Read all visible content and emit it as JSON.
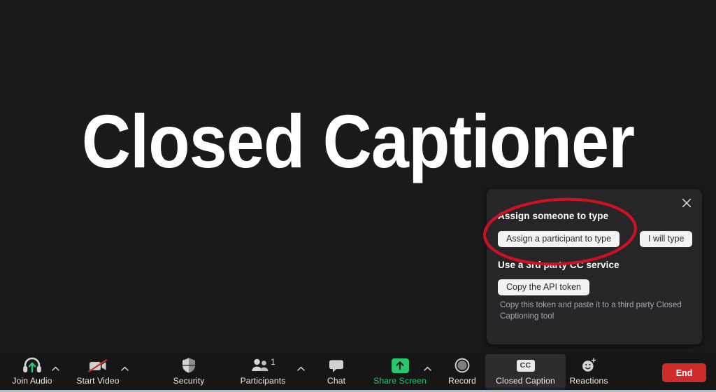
{
  "stage": {
    "title": "Closed Captioner"
  },
  "cc_panel": {
    "close_icon": "close-icon",
    "assign_heading": "Assign someone to type",
    "assign_participant_label": "Assign a participant to type",
    "i_will_type_label": "I will type",
    "third_party_heading": "Use a 3rd party CC service",
    "copy_token_label": "Copy the API token",
    "help_text": "Copy this token and paste it to a third party Closed Captioning tool"
  },
  "annotations": {
    "color": "#cc1122",
    "items": [
      {
        "name": "highlight-assign-section"
      },
      {
        "name": "highlight-closed-caption-button"
      }
    ]
  },
  "toolbar": {
    "items": [
      {
        "label": "Join Audio",
        "icon": "headset-join-audio-icon",
        "caret": true,
        "accent": "#28c76f"
      },
      {
        "label": "Start Video",
        "icon": "camera-off-icon",
        "caret": true,
        "accent": "#c0392b"
      },
      {
        "label": "Security",
        "icon": "shield-icon",
        "caret": false,
        "accent": ""
      },
      {
        "label": "Participants",
        "icon": "people-icon",
        "caret": true,
        "accent": "",
        "count": "1"
      },
      {
        "label": "Chat",
        "icon": "chat-bubble-icon",
        "caret": false,
        "accent": ""
      },
      {
        "label": "Share Screen",
        "icon": "share-screen-up-arrow-icon",
        "caret": true,
        "accent": "#28c76f"
      },
      {
        "label": "Record",
        "icon": "record-circle-icon",
        "caret": false,
        "accent": ""
      },
      {
        "label": "Closed Caption",
        "icon": "cc-icon",
        "caret": false,
        "accent": ""
      },
      {
        "label": "Reactions",
        "icon": "smiley-plus-icon",
        "caret": false,
        "accent": ""
      }
    ],
    "end_label": "End",
    "end_color": "#d02b2b"
  }
}
